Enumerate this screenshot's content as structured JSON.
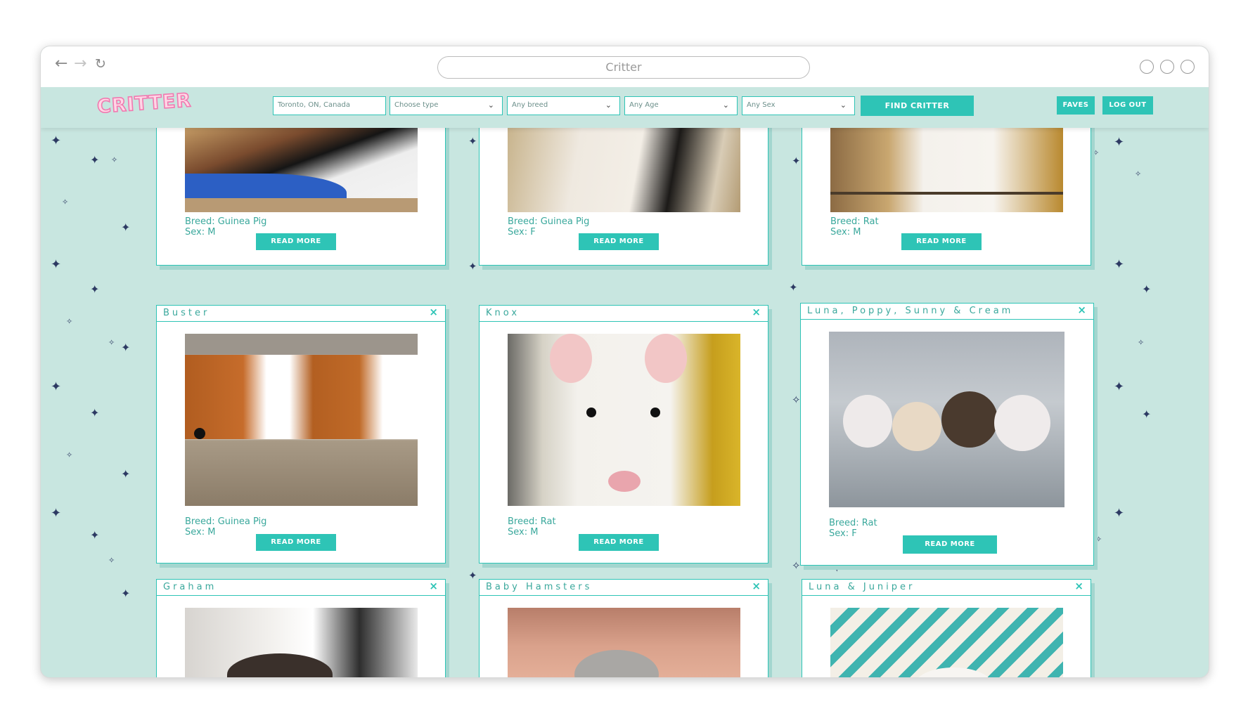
{
  "browser": {
    "address": "Critter"
  },
  "header": {
    "logo": "CRITTER",
    "location_value": "Toronto, ON, Canada",
    "type_select": "Choose type",
    "breed_select": "Any breed",
    "age_select": "Any Age",
    "sex_select": "Any Sex",
    "find_button": "FIND CRITTER",
    "faves_button": "FAVES",
    "logout_button": "LOG OUT"
  },
  "colors": {
    "accent": "#2ec4b6",
    "background": "#c8e6e0",
    "logo_pink": "#f07ab0",
    "star": "#2d3a63"
  },
  "cards": [
    {
      "title": "",
      "breed": "Breed: Guinea Pig",
      "sex": "Sex: M",
      "button": "READ MORE"
    },
    {
      "title": "",
      "breed": "Breed: Guinea Pig",
      "sex": "Sex: F",
      "button": "READ MORE"
    },
    {
      "title": "",
      "breed": "Breed: Rat",
      "sex": "Sex: M",
      "button": "READ MORE"
    },
    {
      "title": "Buster",
      "breed": "Breed: Guinea Pig",
      "sex": "Sex: M",
      "button": "READ MORE",
      "close": "×"
    },
    {
      "title": "Knox",
      "breed": "Breed: Rat",
      "sex": "Sex: M",
      "button": "READ MORE",
      "close": "×"
    },
    {
      "title": "Luna, Poppy, Sunny & Cream",
      "breed": "Breed: Rat",
      "sex": "Sex: F",
      "button": "READ MORE",
      "close": "×"
    },
    {
      "title": "Graham",
      "close": "×"
    },
    {
      "title": "Baby Hamsters",
      "close": "×"
    },
    {
      "title": "Luna & Juniper",
      "close": "×"
    }
  ]
}
